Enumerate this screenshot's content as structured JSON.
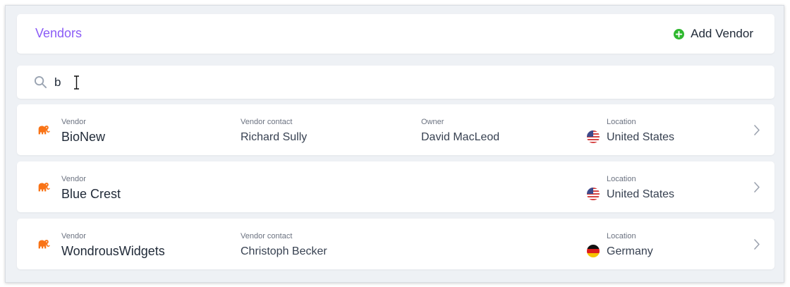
{
  "header": {
    "title": "Vendors",
    "add_button_label": "Add Vendor",
    "add_icon": "plus-circle-icon",
    "accent_color": "#8b5cf6",
    "add_icon_color": "#2fb82f"
  },
  "search": {
    "value": "b",
    "icon": "search-icon"
  },
  "columns": {
    "vendor": "Vendor",
    "contact": "Vendor contact",
    "owner": "Owner",
    "location": "Location"
  },
  "vendors": [
    {
      "name": "BioNew",
      "contact": "Richard Sully",
      "owner": "David MacLeod",
      "location": "United States",
      "flag": "us-flag-icon"
    },
    {
      "name": "Blue Crest",
      "contact": "",
      "owner": "",
      "location": "United States",
      "flag": "us-flag-icon"
    },
    {
      "name": "WondrousWidgets",
      "contact": "Christoph Becker",
      "owner": "",
      "location": "Germany",
      "flag": "germany-flag-icon"
    }
  ],
  "row_icon": "elephant-icon",
  "row_icon_color": "#f97316"
}
